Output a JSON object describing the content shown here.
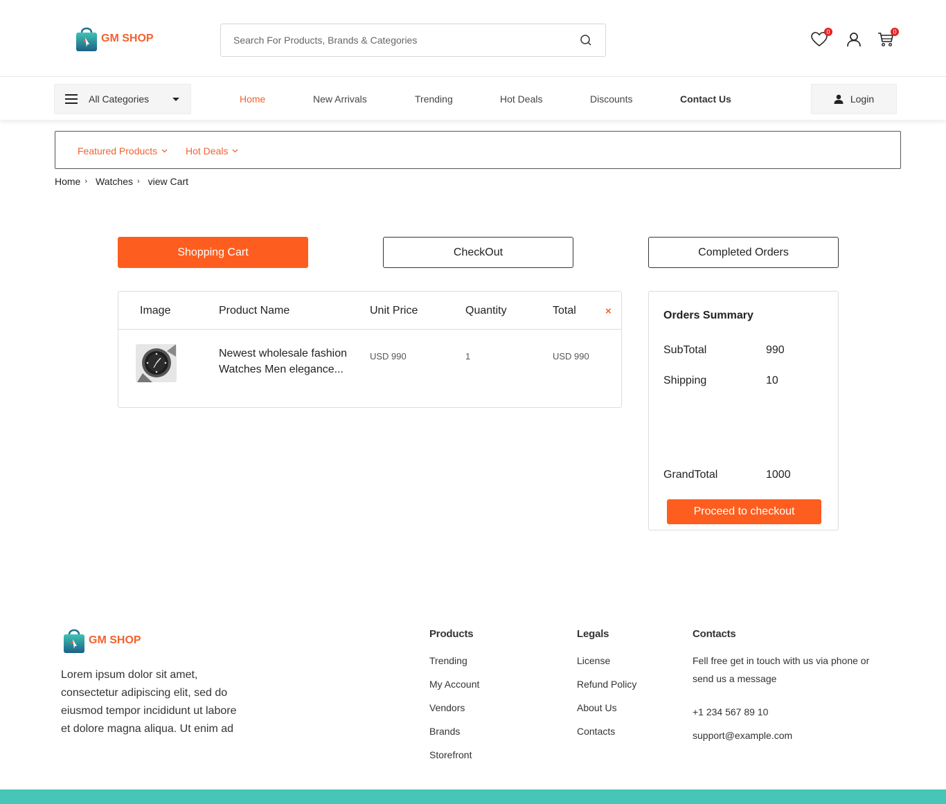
{
  "brand": {
    "name": "GM SHOP",
    "accent": "#fd5e1f",
    "footer_band": "#46c6b6"
  },
  "header": {
    "search_placeholder": "Search For Products, Brands & Categories",
    "wishlist_count": "0",
    "cart_count": "0",
    "icons": [
      "search-icon",
      "heart-icon",
      "user-icon",
      "cart-icon"
    ]
  },
  "nav": {
    "categories_label": "All Categories",
    "links": [
      "Home",
      "New Arrivals",
      "Trending",
      "Hot Deals",
      "Discounts",
      "Contact Us"
    ],
    "active": "Home",
    "login_label": "Login"
  },
  "subnav": {
    "items": [
      "Featured Products",
      "Hot Deals"
    ]
  },
  "breadcrumb": [
    "Home",
    "Watches",
    "view Cart"
  ],
  "steps": [
    "Shopping Cart",
    "CheckOut",
    "Completed Orders"
  ],
  "active_step": "Shopping Cart",
  "cart": {
    "headers": [
      "Image",
      "Product Name",
      "Unit Price",
      "Quantity",
      "Total"
    ],
    "remove_all": "×",
    "rows": [
      {
        "name": "Newest wholesale fashion Watches Men elegance...",
        "unit_price": "USD 990",
        "quantity": "1",
        "total": "USD 990"
      }
    ]
  },
  "summary": {
    "title": "Orders Summary",
    "subtotal_label": "SubTotal",
    "subtotal": "990",
    "shipping_label": "Shipping",
    "shipping": "10",
    "grandtotal_label": "GrandTotal",
    "grandtotal": "1000",
    "proceed_label": "Proceed to checkout"
  },
  "footer": {
    "description": "Lorem ipsum dolor sit amet, consectetur adipiscing elit, sed do eiusmod tempor incididunt ut labore et dolore magna aliqua. Ut enim ad",
    "products": {
      "title": "Products",
      "links": [
        "Trending",
        "My Account",
        "Vendors",
        "Brands",
        "Storefront"
      ]
    },
    "legals": {
      "title": "Legals",
      "links": [
        "License",
        "Refund Policy",
        "About Us",
        "Contacts"
      ]
    },
    "contacts": {
      "title": "Contacts",
      "text": "Fell free get in touch with us via phone or send us a message",
      "phone": "+1 234 567 89 10",
      "email": "support@example.com"
    }
  }
}
